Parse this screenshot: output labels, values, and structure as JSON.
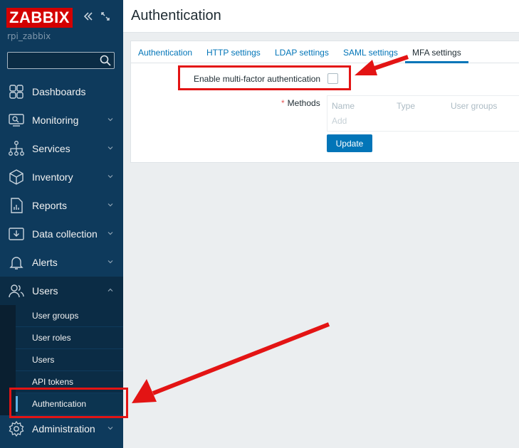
{
  "sidebar": {
    "logo": "ZABBIX",
    "server_name": "rpi_zabbix",
    "search": {
      "placeholder": "",
      "value": ""
    },
    "menu": [
      {
        "label": "Dashboards",
        "icon": "dashboards-icon",
        "has_chevron": false
      },
      {
        "label": "Monitoring",
        "icon": "monitoring-icon",
        "has_chevron": true
      },
      {
        "label": "Services",
        "icon": "services-icon",
        "has_chevron": true
      },
      {
        "label": "Inventory",
        "icon": "inventory-icon",
        "has_chevron": true
      },
      {
        "label": "Reports",
        "icon": "reports-icon",
        "has_chevron": true
      },
      {
        "label": "Data collection",
        "icon": "data-collection-icon",
        "has_chevron": true
      },
      {
        "label": "Alerts",
        "icon": "alerts-icon",
        "has_chevron": true
      },
      {
        "label": "Users",
        "icon": "users-icon",
        "has_chevron": true,
        "expanded": true
      },
      {
        "label": "Administration",
        "icon": "administration-icon",
        "has_chevron": true
      }
    ],
    "users_submenu": [
      "User groups",
      "User roles",
      "Users",
      "API tokens",
      "Authentication"
    ],
    "active_submenu": "Authentication"
  },
  "header": {
    "title": "Authentication"
  },
  "tabs": [
    "Authentication",
    "HTTP settings",
    "LDAP settings",
    "SAML settings",
    "MFA settings"
  ],
  "active_tab": "MFA settings",
  "form": {
    "mfa_label": "Enable multi-factor authentication",
    "mfa_checked": false,
    "methods_label": "Methods",
    "methods_required_mark": "*",
    "methods_columns": [
      "Name",
      "Type",
      "User groups"
    ],
    "add_link": "Add",
    "update_button": "Update"
  },
  "colors": {
    "sidebar_bg": "#0e3a5c",
    "accent": "#0275b8",
    "logo_red": "#d40000",
    "annotation_red": "#e31414"
  }
}
